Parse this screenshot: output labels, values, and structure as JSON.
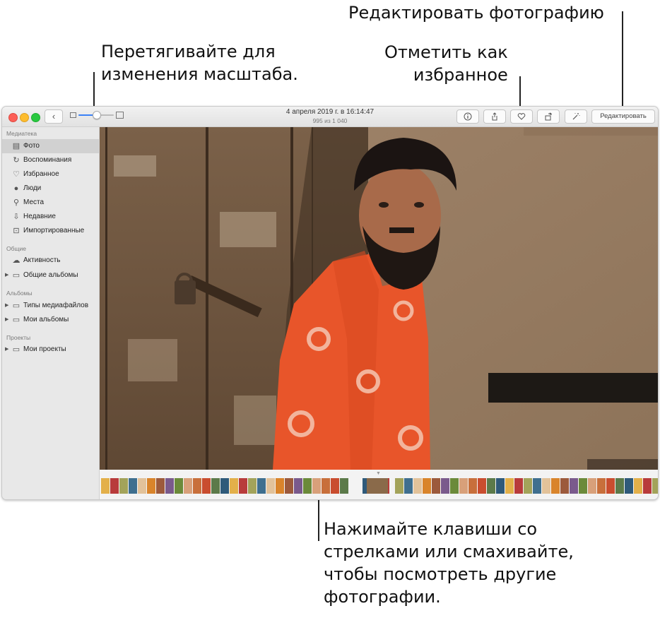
{
  "callouts": {
    "zoom": [
      "Перетягивайте для",
      "изменения масштаба."
    ],
    "edit": [
      "Редактировать фотографию"
    ],
    "favorite": [
      "Отметить как",
      "избранное"
    ],
    "browse": [
      "Нажимайте клавиши со",
      "стрелками или смахивайте,",
      "чтобы посмотреть другие",
      "фотографии."
    ]
  },
  "window": {
    "title": "4 апреля 2019 г. в 16:14:47",
    "subtitle": "995 из 1 040",
    "edit_button": "Редактировать",
    "zoom_level": 0.5
  },
  "sidebar": {
    "sections": [
      {
        "title": "Медиатека",
        "items": [
          {
            "label": "Фото",
            "icon": "photos-icon",
            "selected": true
          },
          {
            "label": "Воспоминания",
            "icon": "memories-icon"
          },
          {
            "label": "Избранное",
            "icon": "heart-icon"
          },
          {
            "label": "Люди",
            "icon": "person-icon"
          },
          {
            "label": "Места",
            "icon": "pin-icon"
          },
          {
            "label": "Недавние",
            "icon": "recent-icon"
          },
          {
            "label": "Импортированные",
            "icon": "import-icon"
          }
        ]
      },
      {
        "title": "Общие",
        "items": [
          {
            "label": "Активность",
            "icon": "cloud-icon"
          },
          {
            "label": "Общие альбомы",
            "icon": "album-stack-icon",
            "disclosure": true
          }
        ]
      },
      {
        "title": "Альбомы",
        "items": [
          {
            "label": "Типы медиафайлов",
            "icon": "album-stack-icon",
            "disclosure": true
          },
          {
            "label": "Мои альбомы",
            "icon": "album-stack-icon",
            "disclosure": true
          }
        ]
      },
      {
        "title": "Проекты",
        "items": [
          {
            "label": "Мои проекты",
            "icon": "album-stack-icon",
            "disclosure": true
          }
        ]
      }
    ]
  },
  "colors": {
    "accent": "#3b82f6",
    "shirt": "#e8552a"
  }
}
